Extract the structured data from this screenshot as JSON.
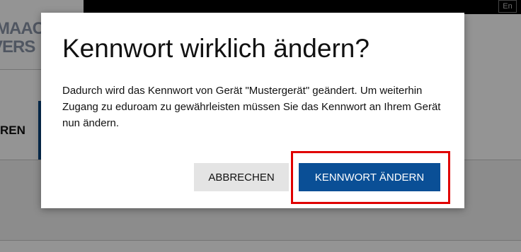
{
  "background": {
    "logo_line_1": "MAACH",
    "logo_line_2": "VERS",
    "nav_label": "REN",
    "language_button": "En"
  },
  "dialog": {
    "title": "Kennwort wirklich ändern?",
    "body": "Dadurch wird das Kennwort von Gerät \"Mustergerät\" geändert. Um weiterhin Zugang zu eduroam zu gewährleisten müssen Sie das Kennwort an Ihrem Gerät nun ändern.",
    "cancel_label": "ABBRECHEN",
    "confirm_label": "KENNWORT ÄNDERN"
  },
  "colors": {
    "primary": "#0a4f96",
    "highlight": "#e00000",
    "overlay": "rgba(0,0,0,0.42)"
  }
}
